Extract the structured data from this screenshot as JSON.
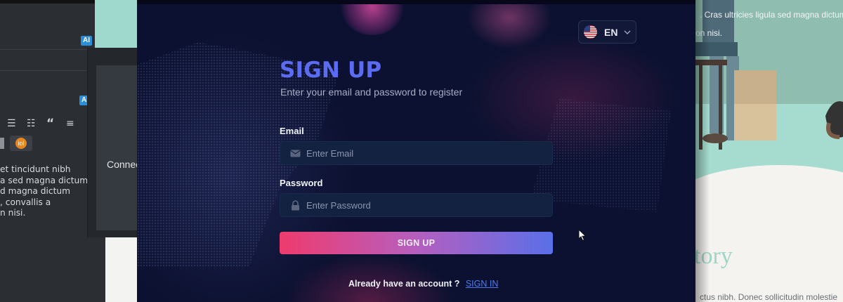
{
  "left_editor": {
    "ai_badge_1": "AI",
    "ai_badge_2": "AI",
    "orange_icon_text": "iol",
    "text_lines": "et tincidunt nibh\na sed magna dictum\nd magna dictum\n, convallis a\nn nisi.",
    "panel_text": "Connec"
  },
  "right_site": {
    "text_line_1": ". Cras ultricies ligula sed magna dictum",
    "text_line_2": "on nisi.",
    "heading_fragment": "tory",
    "text_line_3": "ctus nibh. Donec sollicitudin molestie"
  },
  "modal": {
    "language": {
      "code": "EN",
      "flag_icon": "us-flag-icon"
    },
    "title": "SIGN UP",
    "subtitle": "Enter your email and password to register",
    "email": {
      "label": "Email",
      "placeholder": "Enter Email",
      "value": "",
      "icon": "envelope-icon"
    },
    "password": {
      "label": "Password",
      "placeholder": "Enter Password",
      "value": "",
      "icon": "lock-icon"
    },
    "submit_label": "SIGN UP",
    "signin_prompt": "Already have an account ?",
    "signin_link": "SIGN IN",
    "colors": {
      "accent": "#5b6cf2",
      "button_gradient_start": "#ef3b6d",
      "button_gradient_end": "#5a6fe8",
      "background": "#0c1131"
    }
  }
}
